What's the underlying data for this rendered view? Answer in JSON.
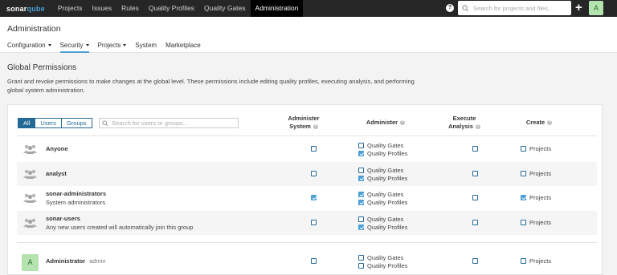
{
  "topnav": {
    "logo_a": "sonar",
    "logo_b": "qube",
    "links": [
      "Projects",
      "Issues",
      "Rules",
      "Quality Profiles",
      "Quality Gates",
      "Administration"
    ],
    "help": "?",
    "search_placeholder": "Search for projects and files...",
    "plus": "+",
    "avatar": "A"
  },
  "admin": {
    "title": "Administration",
    "subnav": [
      "Configuration",
      "Security",
      "Projects",
      "System",
      "Marketplace"
    ]
  },
  "page": {
    "title": "Global Permissions",
    "description": "Grant and revoke permissions to make changes at the global level. These permissions include editing quality profiles, executing analysis, and performing global system administration."
  },
  "filters": {
    "buttons": [
      "All",
      "Users",
      "Groups"
    ],
    "search_placeholder": "Search for users or groups..."
  },
  "columns": {
    "admin_system": "Administer System",
    "administer": "Administer",
    "execute": "Execute Analysis",
    "create": "Create"
  },
  "permission_labels": {
    "quality_gates": "Quality Gates",
    "quality_profiles": "Quality Profiles",
    "projects": "Projects"
  },
  "rows": [
    {
      "name": "Anyone",
      "login": "",
      "description": "",
      "admin_system": false,
      "gates": false,
      "profiles": true,
      "execute": false,
      "create_projects": false
    },
    {
      "name": "analyst",
      "login": "",
      "description": "",
      "admin_system": false,
      "gates": false,
      "profiles": true,
      "execute": false,
      "create_projects": false
    },
    {
      "name": "sonar-administrators",
      "login": "",
      "description": "System administrators",
      "admin_system": true,
      "gates": true,
      "profiles": true,
      "execute": false,
      "create_projects": true
    },
    {
      "name": "sonar-users",
      "login": "",
      "description": "Any new users created will automatically join this group",
      "admin_system": false,
      "gates": false,
      "profiles": true,
      "execute": false,
      "create_projects": false
    },
    {
      "name": "Administrator",
      "login": "admin",
      "avatar": "A",
      "description": "",
      "admin_system": false,
      "gates": false,
      "profiles": false,
      "execute": false,
      "create_projects": false
    }
  ]
}
